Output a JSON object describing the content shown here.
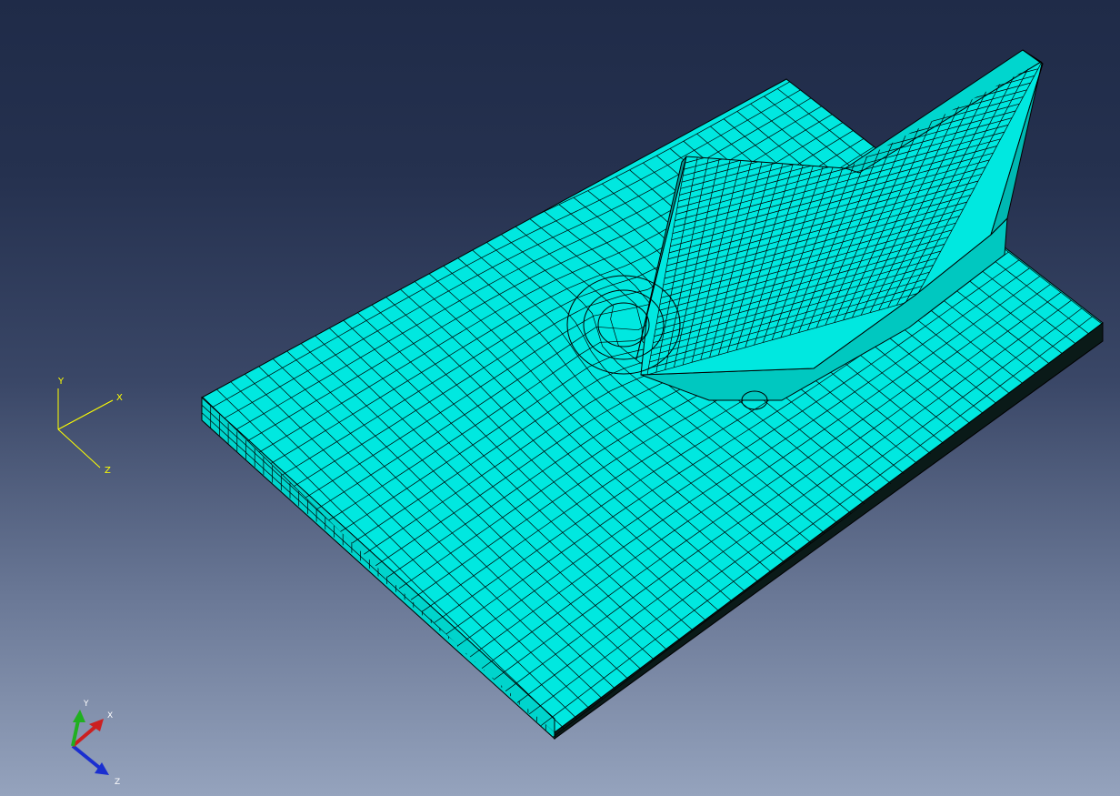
{
  "viewport": {
    "background_top": "#1f2b48",
    "background_bottom": "#95a3bd"
  },
  "model": {
    "mesh_color": "#00e8e0",
    "mesh_shade_color": "#00b8b2",
    "edge_color": "#000000"
  },
  "axes_sketch": {
    "color": "#ffff00",
    "y_label": "Y",
    "x_label": "X",
    "z_label": "Z"
  },
  "triad": {
    "x_color": "#cc2020",
    "y_color": "#20b020",
    "z_color": "#1a2fd0",
    "label_color": "#ffffff",
    "x_label": "X",
    "y_label": "Y",
    "z_label": "Z"
  }
}
